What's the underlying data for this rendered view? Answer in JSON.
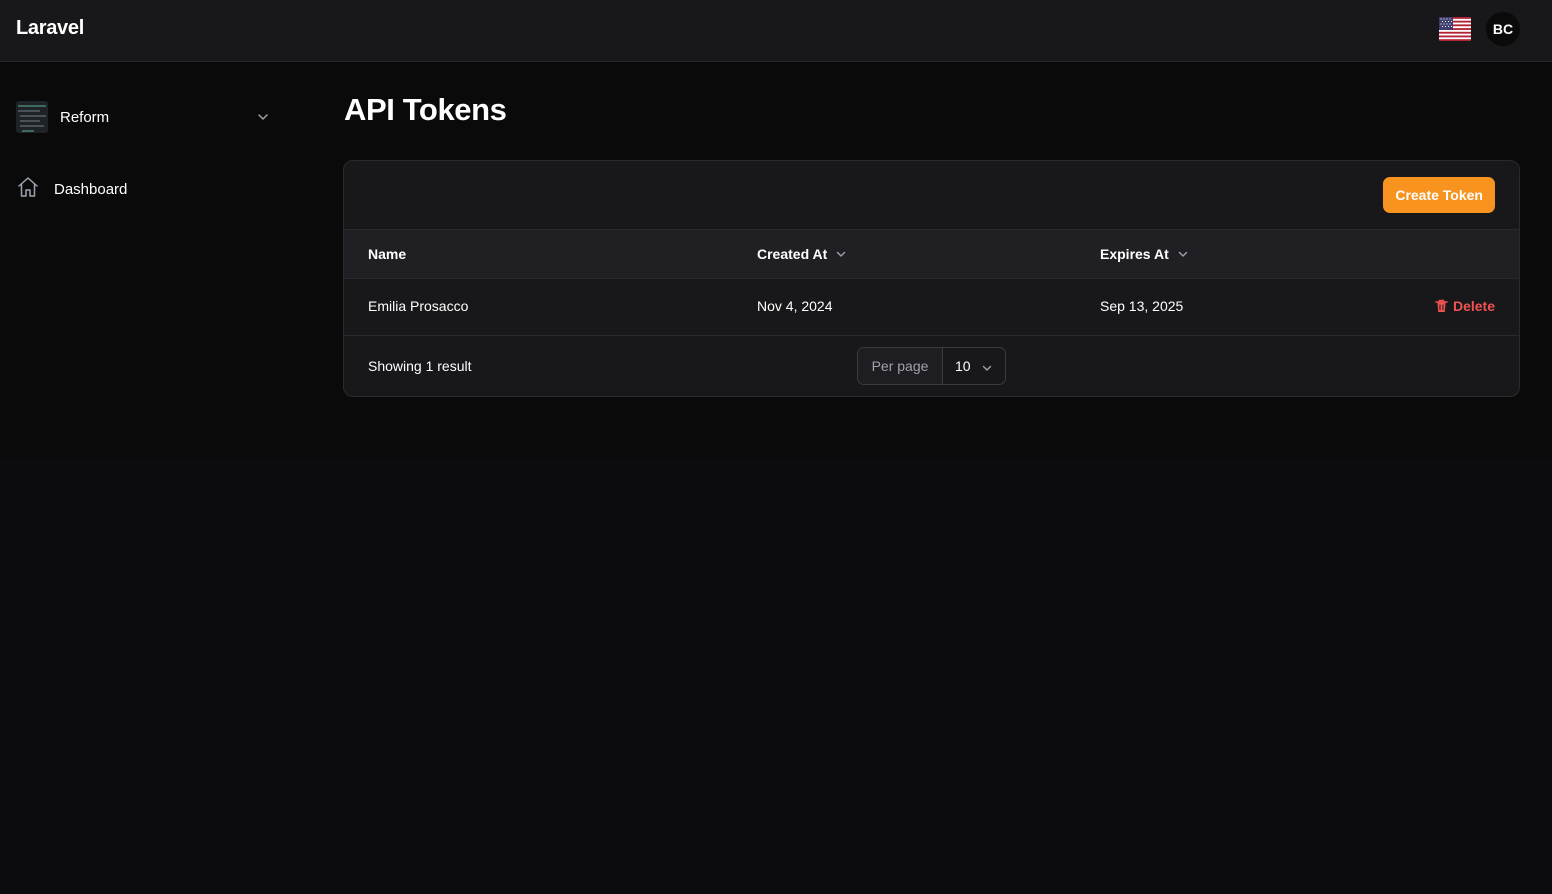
{
  "header": {
    "brand": "Laravel",
    "avatar_initials": "BC",
    "flag": "us-flag-icon"
  },
  "sidebar": {
    "team": {
      "name": "Reform",
      "chevron": "chevron-down-icon"
    },
    "items": [
      {
        "label": "Dashboard",
        "icon": "home-icon"
      }
    ]
  },
  "main": {
    "title": "API Tokens",
    "create_button": "Create Token",
    "table": {
      "columns": [
        {
          "label": "Name",
          "sortable": false
        },
        {
          "label": "Created At",
          "sortable": true
        },
        {
          "label": "Expires At",
          "sortable": true
        }
      ],
      "rows": [
        {
          "name": "Emilia Prosacco",
          "created_at": "Nov 4, 2024",
          "expires_at": "Sep 13, 2025",
          "action": "Delete"
        }
      ]
    },
    "footer": {
      "results_text": "Showing 1 result",
      "per_page_label": "Per page",
      "per_page_value": "10"
    }
  },
  "colors": {
    "accent": "#f7931e",
    "danger": "#f05252",
    "background": "#0c0c0e",
    "surface": "#18181b"
  }
}
